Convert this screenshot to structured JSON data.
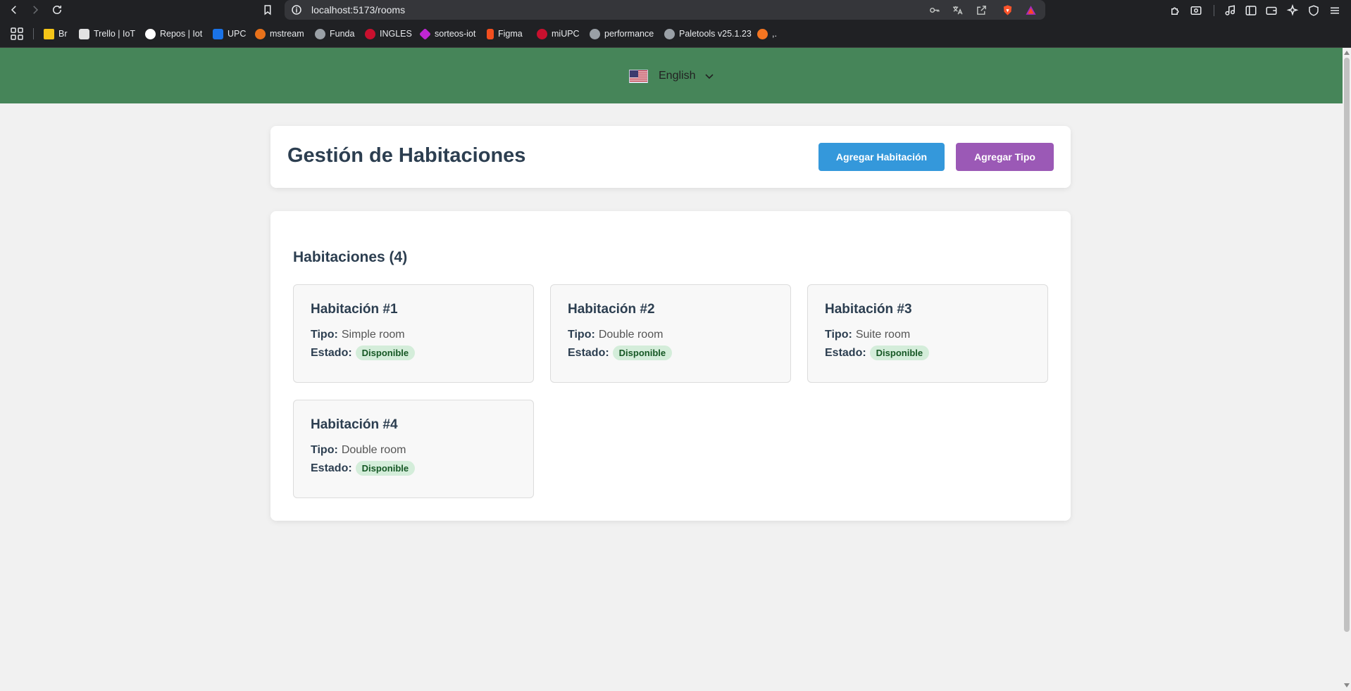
{
  "browser": {
    "url": "localhost:5173/rooms",
    "bookmarks": [
      {
        "label": "Br",
        "icon": "folder-icon",
        "color": "#f5c518"
      },
      {
        "label": "Trello | IoT",
        "icon": "trello-icon",
        "color": "#e2e2e2"
      },
      {
        "label": "Repos | Iot",
        "icon": "github-icon",
        "color": "#ffffff"
      },
      {
        "label": "UPC",
        "icon": "upc-icon",
        "color": "#1a73e8"
      },
      {
        "label": "mstream",
        "icon": "mstream-icon",
        "color": "#e8711a"
      },
      {
        "label": "Funda",
        "icon": "globe-icon",
        "color": "#9aa0a6"
      },
      {
        "label": "INGLES",
        "icon": "upc-red-icon",
        "color": "#c8102e"
      },
      {
        "label": "sorteos-iot",
        "icon": "sorteos-icon",
        "color": "#c026d3"
      },
      {
        "label": "Figma",
        "icon": "figma-icon",
        "color": "#f24e1e"
      },
      {
        "label": "miUPC",
        "icon": "upc-red-icon",
        "color": "#c8102e"
      },
      {
        "label": "performance",
        "icon": "globe-icon",
        "color": "#9aa0a6"
      },
      {
        "label": "Paletools v25.1.23",
        "icon": "globe-icon",
        "color": "#9aa0a6"
      },
      {
        "label": ",.",
        "icon": "crunchyroll-icon",
        "color": "#f47521"
      }
    ]
  },
  "language": {
    "selected": "English",
    "flag": "us-flag-icon"
  },
  "header": {
    "title": "Gestión de Habitaciones",
    "add_room_label": "Agregar Habitación",
    "add_type_label": "Agregar Tipo"
  },
  "rooms": {
    "heading": "Habitaciones (4)",
    "type_label": "Tipo:",
    "state_label": "Estado:",
    "items": [
      {
        "title": "Habitación #1",
        "type": "Simple room",
        "state": "Disponible"
      },
      {
        "title": "Habitación #2",
        "type": "Double room",
        "state": "Disponible"
      },
      {
        "title": "Habitación #3",
        "type": "Suite room",
        "state": "Disponible"
      },
      {
        "title": "Habitación #4",
        "type": "Double room",
        "state": "Disponible"
      }
    ]
  },
  "colors": {
    "header_green": "#468559",
    "add_room_blue": "#3498db",
    "add_type_purple": "#9b59b6",
    "badge_bg": "#d4edda",
    "badge_text": "#155724"
  }
}
